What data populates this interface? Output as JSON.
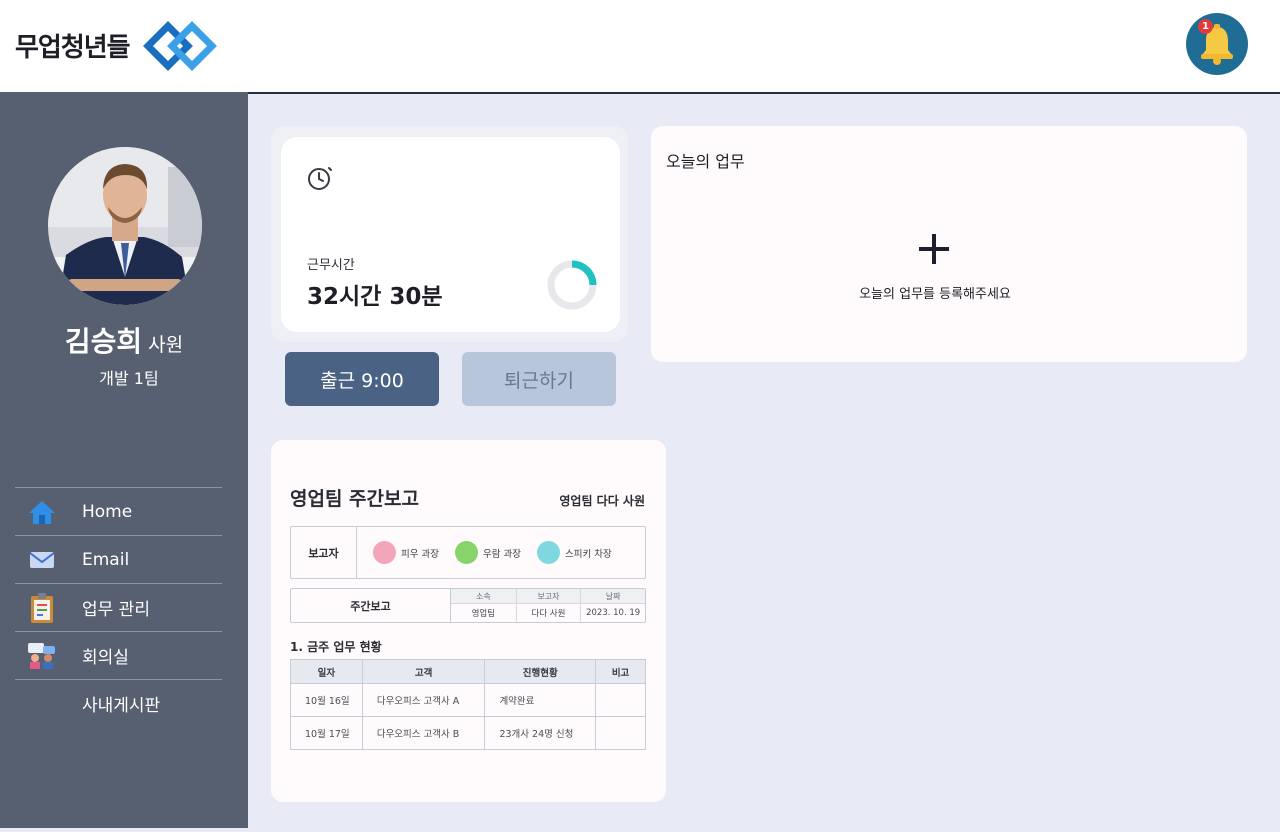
{
  "header": {
    "logo_text": "무업청년들",
    "notification_count": "1"
  },
  "profile": {
    "name": "김승희",
    "rank": "사원",
    "team": "개발 1팀"
  },
  "menu": [
    {
      "label": "Home",
      "icon": "home-icon"
    },
    {
      "label": "Email",
      "icon": "mail-icon"
    },
    {
      "label": "업무 관리",
      "icon": "clipboard-icon"
    },
    {
      "label": "회의실",
      "icon": "meeting-icon"
    },
    {
      "label": "사내게시판",
      "icon": ""
    }
  ],
  "work_time": {
    "label": "근무시간",
    "value": "32시간 30분",
    "progress": 0.25
  },
  "actions": {
    "check_in": "출근 9:00",
    "check_out": "퇴근하기"
  },
  "today_tasks": {
    "title": "오늘의 업무",
    "add_symbol": "+",
    "hint": "오늘의 업무를 등록해주세요"
  },
  "weekly_report": {
    "title": "영업팀 주간보고",
    "author": "영업팀 다다 사원",
    "reporter_label": "보고자",
    "reporters": [
      {
        "name": "피우 과장",
        "color": "#f3a6b8"
      },
      {
        "name": "우람 과장",
        "color": "#86d46a"
      },
      {
        "name": "스피키 차장",
        "color": "#7fd8e0"
      }
    ],
    "meta_label": "주간보고",
    "meta_headers": [
      "소속",
      "보고자",
      "날짜"
    ],
    "meta_values": [
      "영업팀",
      "다다 사원",
      "2023. 10. 19"
    ],
    "section_title": "1. 금주 업무 현황",
    "table_headers": [
      "일자",
      "고객",
      "진행현황",
      "비고"
    ],
    "rows": [
      [
        "10월 16일",
        "다우오피스 고객사 A",
        "계약완료",
        ""
      ],
      [
        "10월 17일",
        "다우오피스 고객사 B",
        "23개사 24명 신청",
        ""
      ]
    ]
  },
  "colors": {
    "sidebar": "#566070",
    "background": "#e8ebf5",
    "primary_button": "#4a6283",
    "ring_accent": "#1fc1c3"
  }
}
